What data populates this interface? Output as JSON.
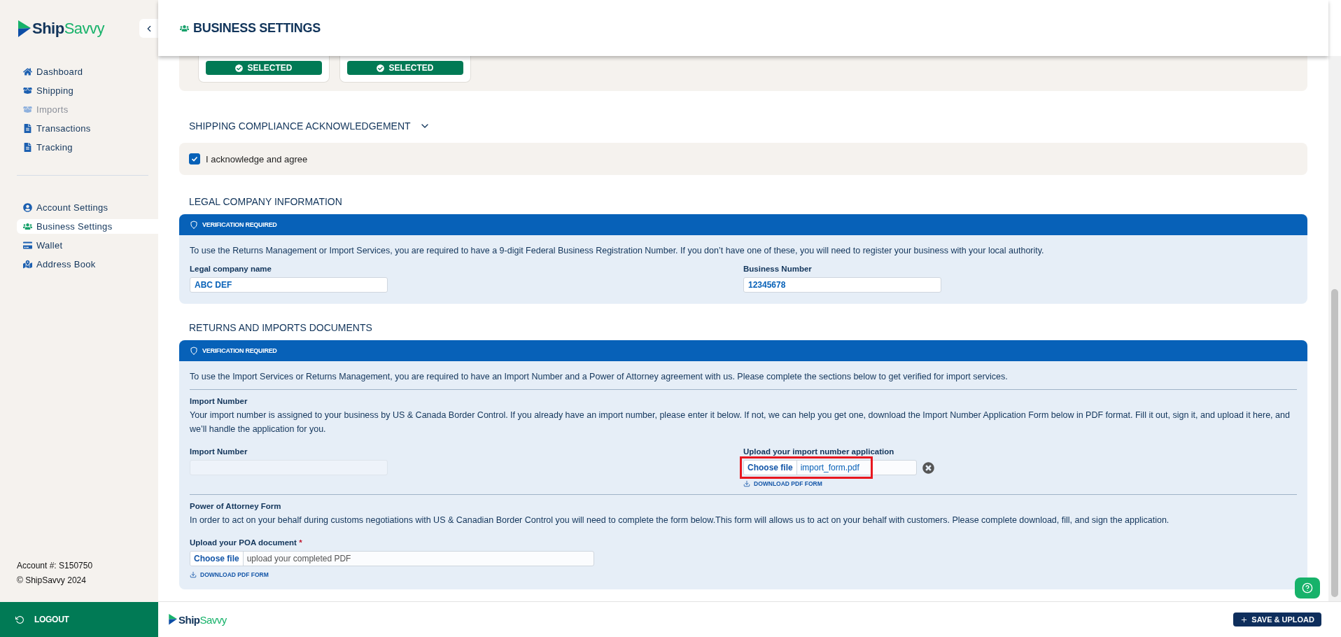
{
  "brand": {
    "part_1": "Ship",
    "part_2": "Savvy"
  },
  "sidebar": {
    "nav": [
      {
        "label": "Dashboard",
        "selected": false,
        "disabled": false
      },
      {
        "label": "Shipping",
        "selected": false,
        "disabled": false
      },
      {
        "label": "Imports",
        "selected": false,
        "disabled": true
      },
      {
        "label": "Transactions",
        "selected": false,
        "disabled": false
      },
      {
        "label": "Tracking",
        "selected": false,
        "disabled": false
      }
    ],
    "account_nav": [
      {
        "label": "Account Settings",
        "selected": false,
        "disabled": false
      },
      {
        "label": "Business Settings",
        "selected": true,
        "disabled": false
      },
      {
        "label": "Wallet",
        "selected": false,
        "disabled": false
      },
      {
        "label": "Address Book",
        "selected": false,
        "disabled": false
      }
    ],
    "account_number": "Account #: S150750",
    "copyright": "© ShipSavvy 2024",
    "logout": "LOGOUT"
  },
  "header": {
    "title": "BUSINESS SETTINGS"
  },
  "plans": [
    {
      "button": "SELECTED"
    },
    {
      "button": "SELECTED"
    }
  ],
  "compliance": {
    "title": "SHIPPING COMPLIANCE ACKNOWLEDGEMENT",
    "checkbox": {
      "label": "I acknowledge and agree",
      "checked": true
    }
  },
  "legal": {
    "title": "LEGAL COMPANY INFORMATION",
    "banner": "VERIFICATION REQUIRED",
    "intro": "To use the Returns Management or Import Services, you are required to have a 9-digit Federal Business Registration Number. If you don’t have one of these, you will need to register your business with your local authority.",
    "fields": [
      {
        "label": "Legal company name",
        "value": "ABC DEF"
      },
      {
        "label": "Business Number",
        "value": "12345678"
      }
    ]
  },
  "returns": {
    "title": "RETURNS AND IMPORTS DOCUMENTS",
    "banner": "VERIFICATION REQUIRED",
    "intro": "To use the Import Services or Returns Management, you are required to have an Import Number and a Power of Attorney agreement with us. Please complete the sections below to get verified for import services.",
    "import_number": {
      "title": "Import Number",
      "text": "Your import number is assigned to your business by US & Canada Border Control. If you already have an import number, please enter it below. If not, we can help you get one, download the Import Number Application Form below in PDF format. Fill it out, sign it, and upload it here, and we’ll handle the application for you.",
      "field_label": "Import Number",
      "upload": {
        "label": "Upload your import number application",
        "button": "Choose file",
        "file": "import_form.pdf",
        "highlighted": true,
        "link": "DOWNLOAD PDF FORM"
      }
    },
    "poa": {
      "title": "Power of Attorney Form",
      "text": "In order to act on your behalf during customs negotiations with US & Canadian Border Control you will need to complete the form below.This form will allows us to act on your behalf with customers. Please complete download, fill, and sign the application.",
      "upload": {
        "label": "Upload your POA document",
        "required_mark": "*",
        "button": "Choose file",
        "placeholder": "upload your completed PDF",
        "link": "DOWNLOAD PDF FORM"
      }
    }
  },
  "footer": {
    "brand": {
      "part_1": "Ship",
      "part_2": "Savvy"
    },
    "save": "SAVE & UPLOAD"
  }
}
